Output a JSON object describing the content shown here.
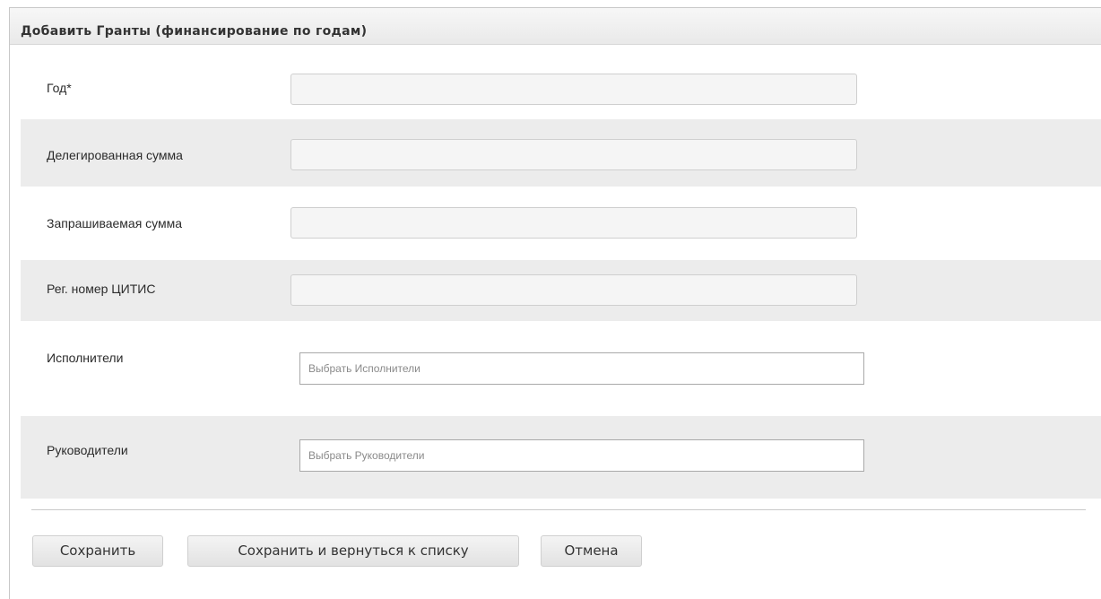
{
  "header": {
    "title": "Добавить Гранты (финансирование по годам)"
  },
  "form": {
    "fields": [
      {
        "label": "Год*",
        "value": "",
        "type": "text"
      },
      {
        "label": "Делегированная сумма",
        "value": "",
        "type": "text"
      },
      {
        "label": "Запрашиваемая сумма",
        "value": "",
        "type": "text"
      },
      {
        "label": "Рег. номер ЦИТИС",
        "value": "",
        "type": "text"
      },
      {
        "label": "Исполнители",
        "placeholder": "Выбрать Исполнители",
        "type": "multiselect"
      },
      {
        "label": "Руководители",
        "placeholder": "Выбрать Руководители",
        "type": "multiselect"
      }
    ]
  },
  "actions": {
    "save": "Сохранить",
    "save_and_return": "Сохранить и вернуться к списку",
    "cancel": "Отмена"
  },
  "colors": {
    "row_shade": "#ececec",
    "input_bg": "#f5f5f5",
    "button_gradient_top": "#f4f4f4",
    "button_gradient_bottom": "#e2e2e2"
  }
}
